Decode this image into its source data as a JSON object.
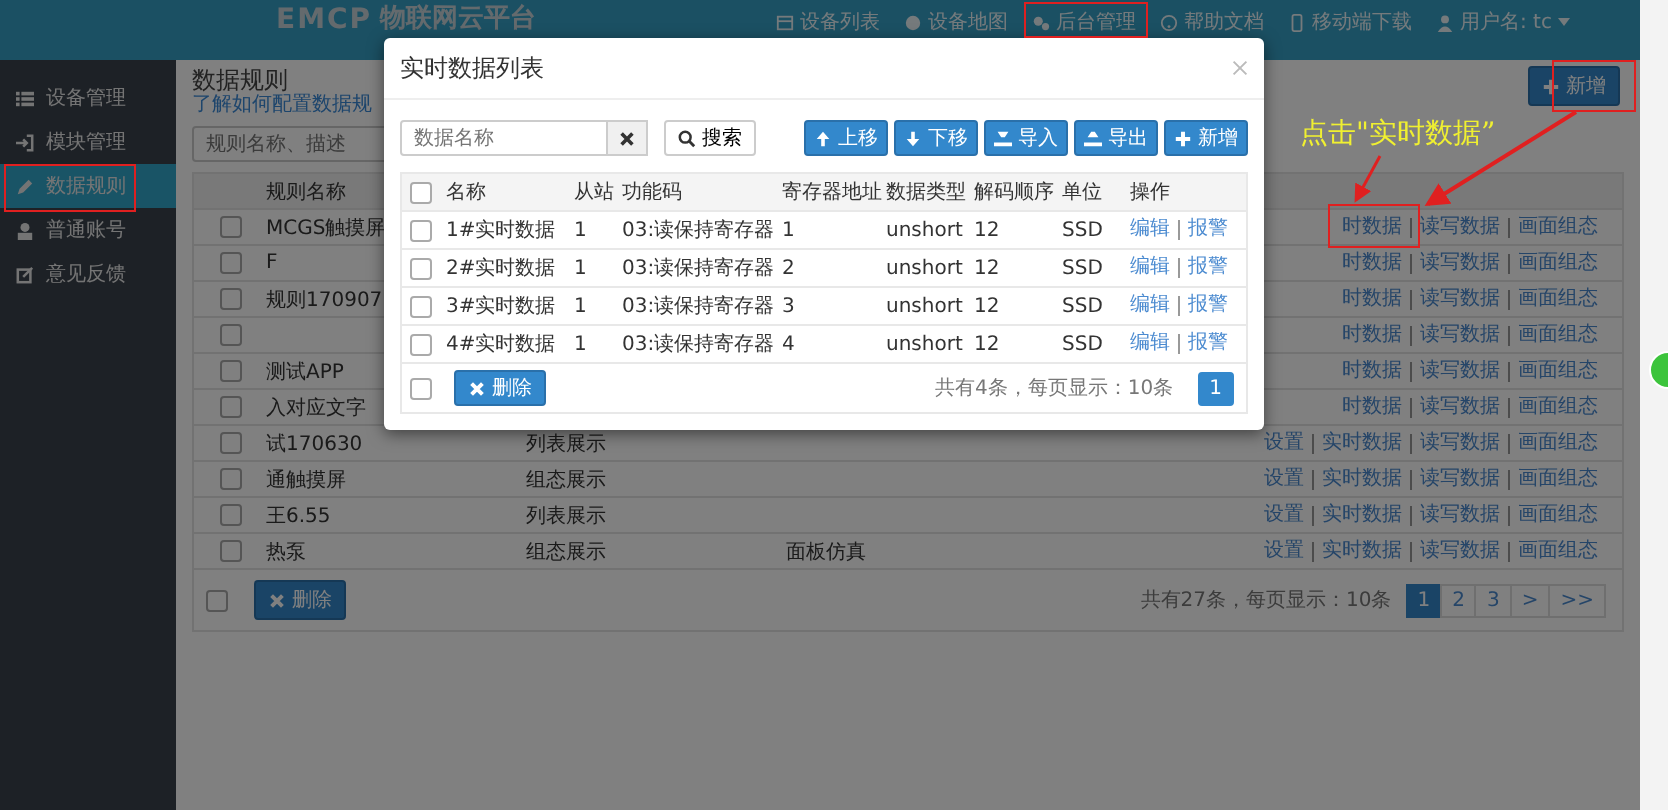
{
  "topbar": {
    "logo_latin": "EMCP",
    "logo_cn": "物联网云平台",
    "nav": [
      "设备列表",
      "设备地图",
      "后台管理",
      "帮助文档",
      "移动端下载"
    ],
    "user": "用户名: tc"
  },
  "sidebar": {
    "items": [
      {
        "label": "设备管理",
        "selected": false
      },
      {
        "label": "模块管理",
        "selected": false
      },
      {
        "label": "数据规则",
        "selected": true
      },
      {
        "label": "普通账号",
        "selected": false
      },
      {
        "label": "意见反馈",
        "selected": false
      }
    ]
  },
  "main": {
    "title": "数据规则",
    "help_link": "了解如何配置数据规",
    "add_button": "新增",
    "search": {
      "placeholder": "规则名称、描述"
    },
    "table": {
      "name_header": "规则名称",
      "rows": [
        {
          "checked": false,
          "name": "MCGS触摸屏",
          "actions": [
            "时数据",
            "读写数据",
            "画面组态"
          ]
        },
        {
          "checked": false,
          "name": "F",
          "actions": [
            "时数据",
            "读写数据",
            "画面组态"
          ]
        },
        {
          "checked": false,
          "name": "规则170907",
          "actions": [
            "时数据",
            "读写数据",
            "画面组态"
          ]
        },
        {
          "checked": false,
          "actions": [
            "时数据",
            "读写数据",
            "画面组态"
          ]
        },
        {
          "checked": false,
          "name": "测试APP",
          "actions": [
            "时数据",
            "读写数据",
            "画面组态"
          ]
        },
        {
          "checked": false,
          "name": "入对应文字",
          "actions": [
            "时数据",
            "读写数据",
            "画面组态"
          ]
        },
        {
          "checked": false,
          "name": "试170630",
          "display": "列表展示",
          "actions": [
            "设置",
            "实时数据",
            "读写数据",
            "画面组态"
          ]
        },
        {
          "checked": false,
          "name": "通触摸屏",
          "display": "组态展示",
          "actions": [
            "设置",
            "实时数据",
            "读写数据",
            "画面组态"
          ]
        },
        {
          "checked": false,
          "name": "王6.55",
          "display": "列表展示",
          "actions": [
            "设置",
            "实时数据",
            "读写数据",
            "画面组态"
          ]
        },
        {
          "checked": false,
          "name": "热泵",
          "display": "组态展示",
          "column_4": "面板仿真",
          "actions": [
            "设置",
            "实时数据",
            "读写数据",
            "画面组态"
          ]
        }
      ],
      "footer_checked": false,
      "delete_button": "删除",
      "summary": "共有27条，每页显示：10条",
      "pages": [
        {
          "label": "1",
          "selected": true
        },
        {
          "label": "2",
          "selected": false
        },
        {
          "label": "3",
          "selected": false
        },
        {
          "label": ">",
          "selected": false
        },
        {
          "label": ">>",
          "selected": false
        }
      ]
    }
  },
  "modal": {
    "title": "实时数据列表",
    "search": {
      "placeholder": "数据名称"
    },
    "search_button": "搜索",
    "toolbar": [
      "上移",
      "下移",
      "导入",
      "导出",
      "新增"
    ],
    "columns": [
      "名称",
      "从站",
      "功能码",
      "寄存器地址",
      "数据类型",
      "解码顺序",
      "单位",
      "操作"
    ],
    "header_checked": false,
    "rows": [
      {
        "checked": false,
        "cells": [
          "1#实时数据",
          "1",
          "03:读保持寄存器",
          "1",
          "unshort",
          "12",
          "SSD"
        ],
        "actions": [
          "编辑",
          "报警"
        ]
      },
      {
        "checked": false,
        "cells": [
          "2#实时数据",
          "1",
          "03:读保持寄存器",
          "2",
          "unshort",
          "12",
          "SSD"
        ],
        "actions": [
          "编辑",
          "报警"
        ]
      },
      {
        "checked": false,
        "cells": [
          "3#实时数据",
          "1",
          "03:读保持寄存器",
          "3",
          "unshort",
          "12",
          "SSD"
        ],
        "actions": [
          "编辑",
          "报警"
        ]
      },
      {
        "checked": false,
        "cells": [
          "4#实时数据",
          "1",
          "03:读保持寄存器",
          "4",
          "unshort",
          "12",
          "SSD"
        ],
        "actions": [
          "编辑",
          "报警"
        ]
      }
    ],
    "footer_checked": false,
    "delete_button": "删除",
    "summary": "共有4条，每页显示：10条",
    "pages": [
      {
        "label": "1",
        "selected": true
      }
    ]
  },
  "annotation": {
    "text": "点击\"实时数据”"
  }
}
